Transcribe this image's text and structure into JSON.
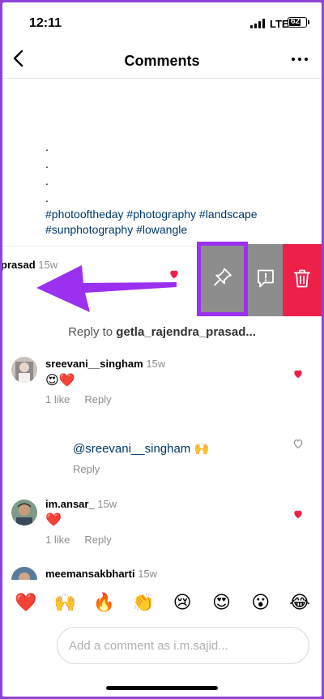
{
  "status_bar": {
    "time": "12:11",
    "network": "LTE",
    "battery": "62"
  },
  "header": {
    "title": "Comments",
    "back_icon": "chevron-left-icon",
    "more_icon": "more-horizontal-icon"
  },
  "caption": {
    "dots": [
      ".",
      ".",
      ".",
      "."
    ],
    "hashtags_line1": "#photooftheday #photography #landscape",
    "hashtags_line2": "#sunphotography #lowangle"
  },
  "swiped_comment": {
    "username": "prasad",
    "time": "15w",
    "actions": [
      {
        "name": "pin",
        "icon": "pin-icon",
        "color": "#8d8d8d"
      },
      {
        "name": "report",
        "icon": "report-icon",
        "color": "#8d8d8d"
      },
      {
        "name": "delete",
        "icon": "trash-icon",
        "color": "#ed2049"
      }
    ],
    "highlight_color": "#9b30f0",
    "arrow_color": "#9b30f0"
  },
  "reply_to": {
    "prefix": "Reply to ",
    "username": "getla_rajendra_prasad..."
  },
  "comments": [
    {
      "username": "sreevani__singham",
      "time": "15w",
      "text": "😍❤️",
      "likes": "1 like",
      "reply": "Reply",
      "liked": true
    },
    {
      "username": "",
      "mention": "@sreevani__singham 🙌",
      "reply": "Reply",
      "liked": false
    },
    {
      "username": "im.ansar_",
      "time": "15w",
      "text": "❤️",
      "likes": "1 like",
      "reply": "Reply",
      "liked": true
    },
    {
      "username": "meemansakbharti",
      "time": "15w"
    }
  ],
  "emoji_bar": [
    "❤️",
    "🙌",
    "🔥",
    "👏",
    "😢",
    "😍",
    "😮",
    "😂"
  ],
  "comment_input": {
    "placeholder": "Add a comment as i.m.sajid..."
  },
  "colors": {
    "heart": "#ed2049",
    "link": "#00376b",
    "accent": "#9b30f0"
  }
}
